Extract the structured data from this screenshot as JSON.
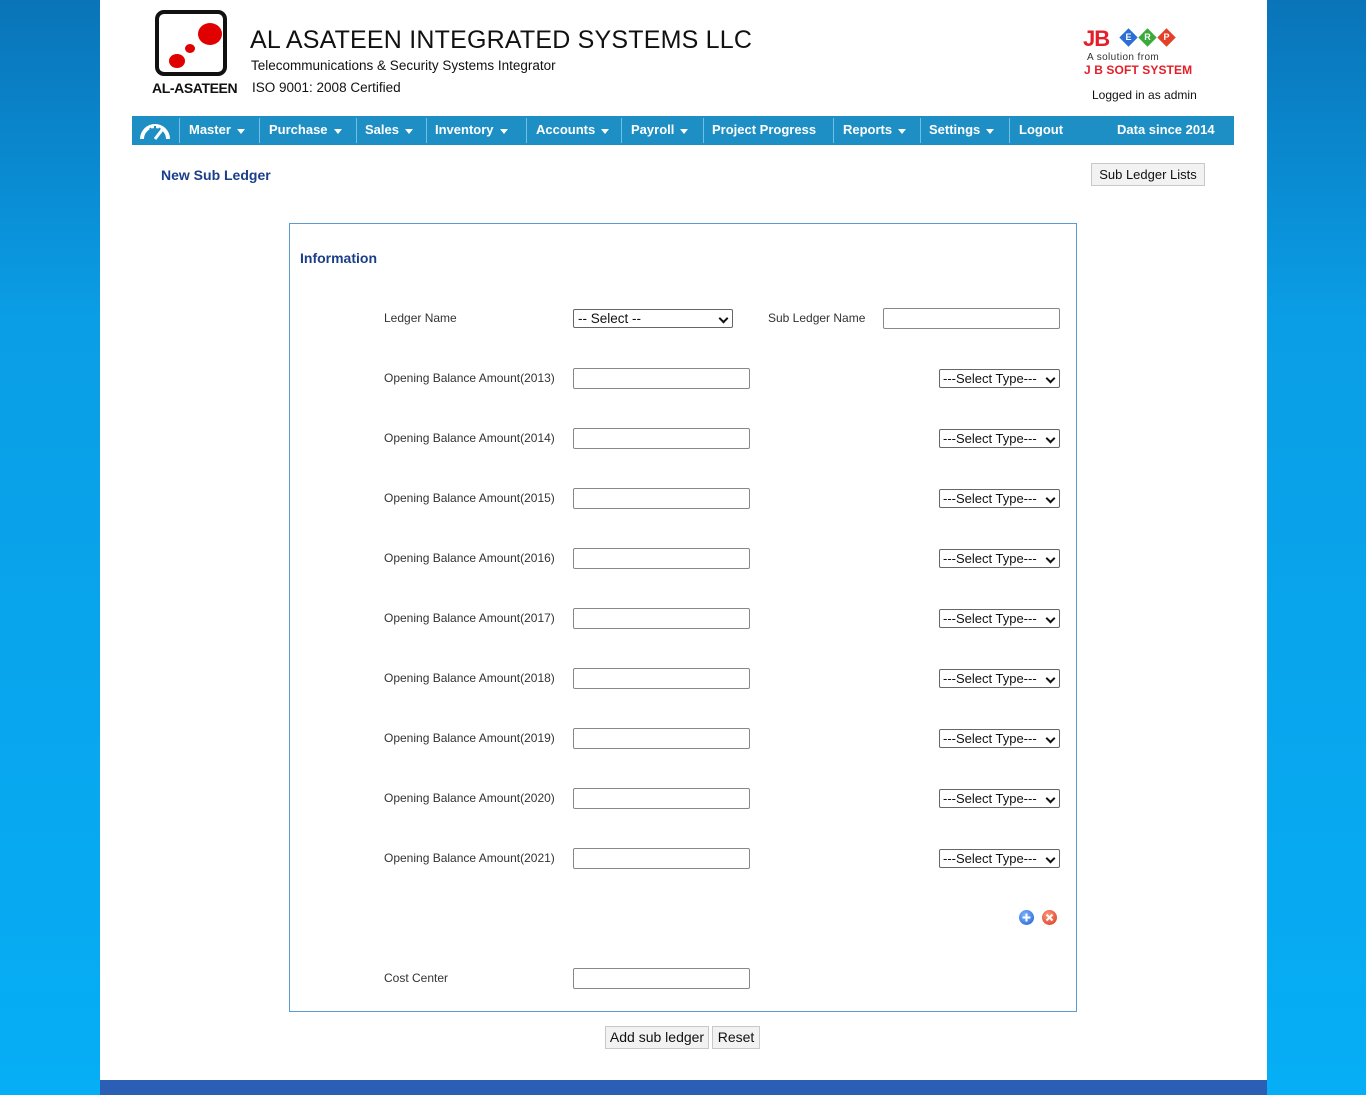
{
  "header": {
    "logo_word": "AL-ASATEEN",
    "company_name": "AL ASATEEN INTEGRATED SYSTEMS LLC",
    "tagline": "Telecommunications & Security Systems Integrator",
    "iso": "ISO 9001: 2008 Certified",
    "brand_main": "JB",
    "brand_letters": [
      "E",
      "R",
      "P"
    ],
    "brand_sub1": "A solution from",
    "brand_sub2": "J B SOFT SYSTEM",
    "logged_in": "Logged in as admin"
  },
  "nav": {
    "dashboard_icon": "speedometer-icon",
    "items": [
      {
        "label": "Master"
      },
      {
        "label": "Purchase"
      },
      {
        "label": "Sales"
      },
      {
        "label": "Inventory"
      },
      {
        "label": "Accounts"
      },
      {
        "label": "Payroll"
      },
      {
        "label": "Project Progress"
      },
      {
        "label": "Reports"
      },
      {
        "label": "Settings"
      },
      {
        "label": "Logout"
      }
    ],
    "data_since": "Data since 2014"
  },
  "page": {
    "title": "New Sub Ledger",
    "list_button": "Sub Ledger Lists"
  },
  "form": {
    "section_title": "Information",
    "ledger_name_label": "Ledger Name",
    "ledger_name_value": "-- Select --",
    "sub_ledger_name_label": "Sub Ledger Name",
    "sub_ledger_name_value": "",
    "opening_balances": [
      {
        "label": "Opening Balance Amount(2013)",
        "value": "",
        "type": "---Select Type---"
      },
      {
        "label": "Opening Balance Amount(2014)",
        "value": "",
        "type": "---Select Type---"
      },
      {
        "label": "Opening Balance Amount(2015)",
        "value": "",
        "type": "---Select Type---"
      },
      {
        "label": "Opening Balance Amount(2016)",
        "value": "",
        "type": "---Select Type---"
      },
      {
        "label": "Opening Balance Amount(2017)",
        "value": "",
        "type": "---Select Type---"
      },
      {
        "label": "Opening Balance Amount(2018)",
        "value": "",
        "type": "---Select Type---"
      },
      {
        "label": "Opening Balance Amount(2019)",
        "value": "",
        "type": "---Select Type---"
      },
      {
        "label": "Opening Balance Amount(2020)",
        "value": "",
        "type": "---Select Type---"
      },
      {
        "label": "Opening Balance Amount(2021)",
        "value": "",
        "type": "---Select Type---"
      }
    ],
    "add_row_icon": "plus-circle-icon",
    "remove_row_icon": "close-circle-icon",
    "cost_center_label": "Cost Center",
    "cost_center_value": ""
  },
  "actions": {
    "submit": "Add sub ledger",
    "reset": "Reset"
  },
  "colors": {
    "nav_bg": "#1e8fc4",
    "title_blue": "#1a3e8a",
    "form_border": "#5b9bd0",
    "brand_red": "#e3202a",
    "footer_bar": "#2b5fb5"
  }
}
